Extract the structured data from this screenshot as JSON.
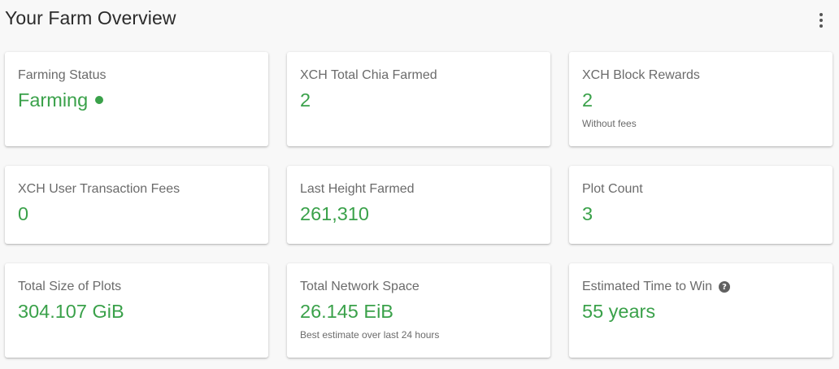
{
  "header": {
    "title": "Your Farm Overview",
    "more_icon": "more-vert-icon"
  },
  "colors": {
    "accent_green": "#3aa14a",
    "label_gray": "#6b6b6b",
    "background": "#f8f8f8"
  },
  "cards": [
    {
      "title": "Farming Status",
      "value": "Farming",
      "status_icon": "status-dot-icon"
    },
    {
      "title": "XCH Total Chia Farmed",
      "value": "2"
    },
    {
      "title": "XCH Block Rewards",
      "value": "2",
      "sub": "Without fees"
    },
    {
      "title": "XCH User Transaction Fees",
      "value": "0"
    },
    {
      "title": "Last Height Farmed",
      "value": "261,310"
    },
    {
      "title": "Plot Count",
      "value": "3"
    },
    {
      "title": "Total Size of Plots",
      "value": "304.107 GiB"
    },
    {
      "title": "Total Network Space",
      "value": "26.145 EiB",
      "sub": "Best estimate over last 24 hours"
    },
    {
      "title": "Estimated Time to Win",
      "value": "55 years",
      "help_icon": "?"
    }
  ]
}
